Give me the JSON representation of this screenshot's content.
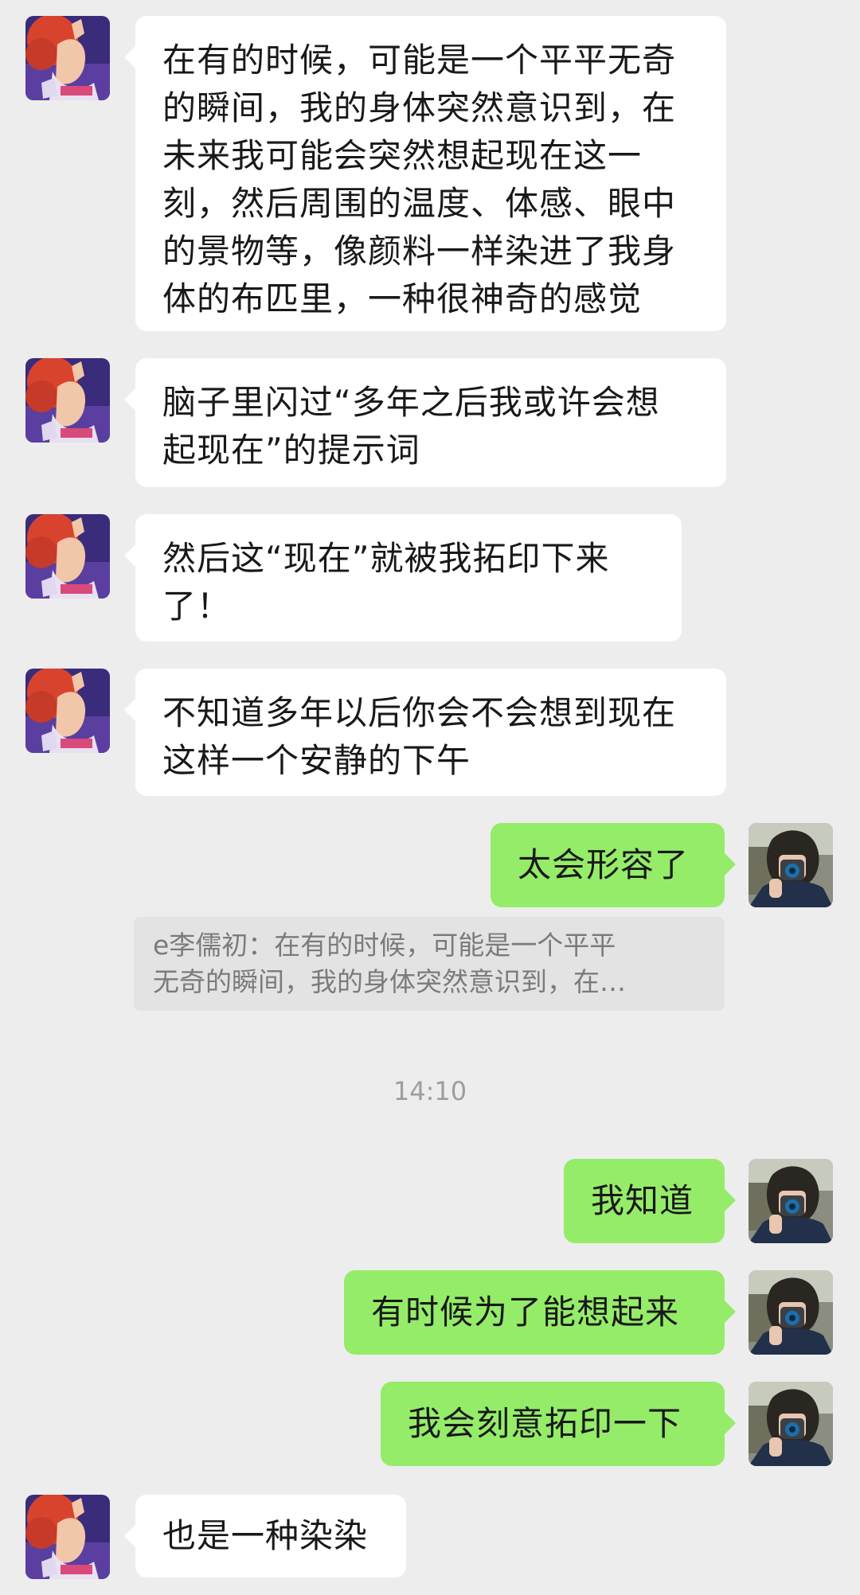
{
  "messages": [
    {
      "side": "in",
      "lines": [
        "在有的时候，可能是一个平平无奇",
        "的瞬间，我的身体突然意识到，在",
        "未来我可能会突然想起现在这一",
        "刻，然后周围的温度、体感、眼中",
        "的景物等，像颜料一样染进了我身",
        "体的布匹里，一种很神奇的感觉"
      ]
    },
    {
      "side": "in",
      "lines": [
        "脑子里闪过“多年之后我或许会想",
        "起现在”的提示词"
      ]
    },
    {
      "side": "in",
      "lines": [
        "然后这“现在”就被我拓印下来",
        "了！"
      ]
    },
    {
      "side": "in",
      "lines": [
        "不知道多年以后你会不会想到现在",
        "这样一个安静的下午"
      ]
    },
    {
      "side": "out",
      "lines": [
        "太会形容了"
      ]
    },
    {
      "side": "out",
      "lines": [
        "我知道"
      ]
    },
    {
      "side": "out",
      "lines": [
        "有时候为了能想起来"
      ]
    },
    {
      "side": "out",
      "lines": [
        "我会刻意拓印一下"
      ]
    },
    {
      "side": "in",
      "lines": [
        "也是一种染染"
      ]
    }
  ],
  "quote": {
    "lines": [
      "e李儒初：在有的时候，可能是一个平平",
      "无奇的瞬间，我的身体突然意识到，在…"
    ]
  },
  "timestamp": "14:10",
  "colors": {
    "background": "#ededed",
    "incoming": "#ffffff",
    "outgoing": "#95ec69",
    "quote": "#e3e3e3"
  },
  "avatars": {
    "contact": "anime-character-avatar",
    "self": "photo-portrait-avatar"
  }
}
